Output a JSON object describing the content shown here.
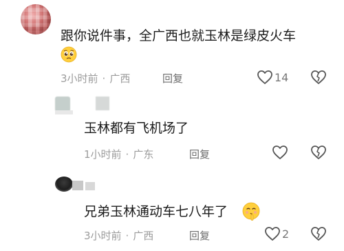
{
  "comments": [
    {
      "text": "跟你说件事，全广西也就玉林是绿皮火车",
      "time": "3小时前",
      "location": "广西",
      "reply_label": "回复",
      "likes": "14",
      "emoji_icon": "pleading-face-icon"
    },
    {
      "text": "玉林都有飞机场了",
      "time": "1小时前",
      "location": "广东",
      "reply_label": "回复",
      "likes": ""
    },
    {
      "text": "兄弟玉林通动车七八年了",
      "time": "3小时前",
      "location": "广西",
      "reply_label": "回复",
      "likes": "2",
      "emoji_icon": "shushing-face-icon"
    }
  ],
  "separator": "·",
  "colors": {
    "text": "#1b1b1b",
    "meta": "#9b9b9b",
    "icon": "#555555",
    "background": "#ffffff"
  }
}
